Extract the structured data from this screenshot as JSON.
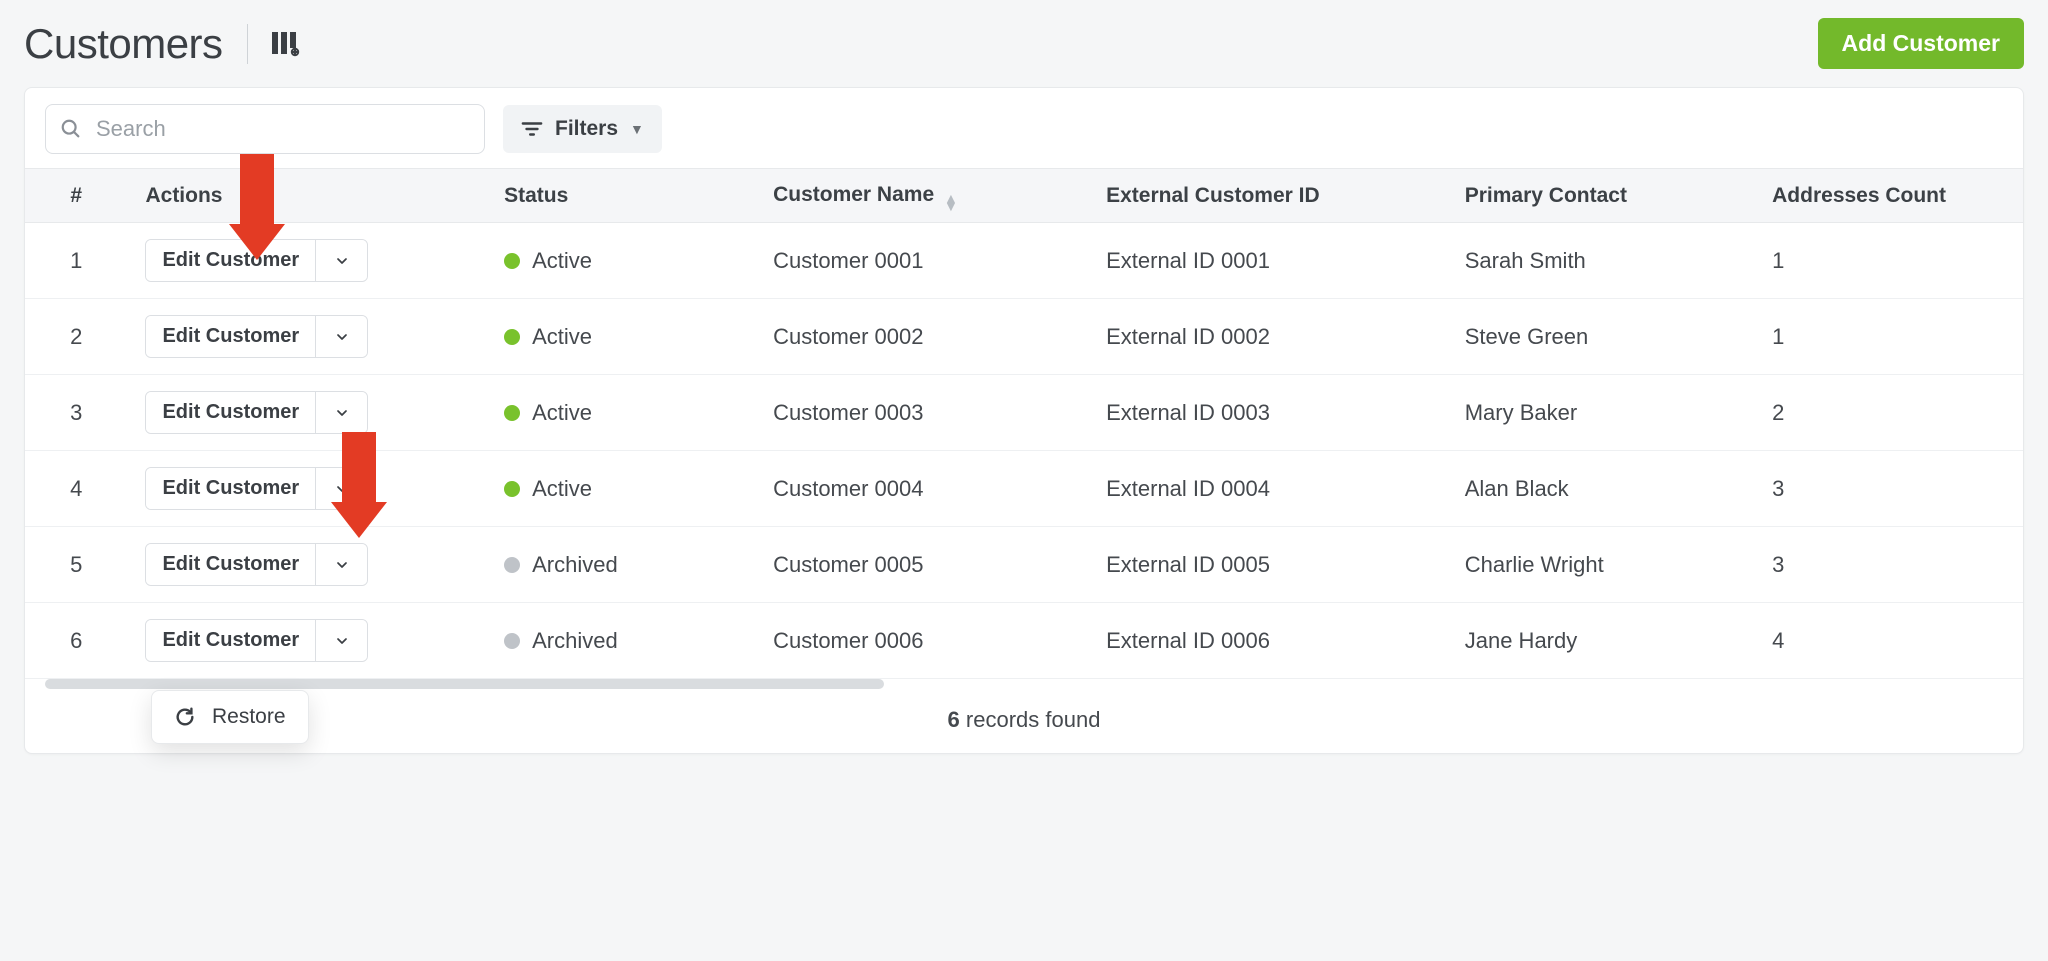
{
  "header": {
    "title": "Customers",
    "add_button": "Add Customer"
  },
  "toolbar": {
    "search_placeholder": "Search",
    "filters_label": "Filters"
  },
  "columns": {
    "num": "#",
    "actions": "Actions",
    "status": "Status",
    "name": "Customer Name",
    "external_id": "External Customer ID",
    "primary_contact": "Primary Contact",
    "addresses": "Addresses Count"
  },
  "action_label": "Edit Customer",
  "status_labels": {
    "active": "Active",
    "archived": "Archived"
  },
  "rows": [
    {
      "n": "1",
      "status": "active",
      "name": "Customer 0001",
      "ext": "External ID 0001",
      "contact": "Sarah Smith",
      "addr": "1"
    },
    {
      "n": "2",
      "status": "active",
      "name": "Customer 0002",
      "ext": "External ID 0002",
      "contact": "Steve Green",
      "addr": "1"
    },
    {
      "n": "3",
      "status": "active",
      "name": "Customer 0003",
      "ext": "External ID 0003",
      "contact": "Mary Baker",
      "addr": "2"
    },
    {
      "n": "4",
      "status": "active",
      "name": "Customer 0004",
      "ext": "External ID 0004",
      "contact": "Alan Black",
      "addr": "3"
    },
    {
      "n": "5",
      "status": "archived",
      "name": "Customer 0005",
      "ext": "External ID 0005",
      "contact": "Charlie Wright",
      "addr": "3"
    },
    {
      "n": "6",
      "status": "archived",
      "name": "Customer 0006",
      "ext": "External ID 0006",
      "contact": "Jane Hardy",
      "addr": "4"
    }
  ],
  "menu": {
    "restore": "Restore"
  },
  "footer": {
    "count": "6",
    "suffix": "records found"
  }
}
